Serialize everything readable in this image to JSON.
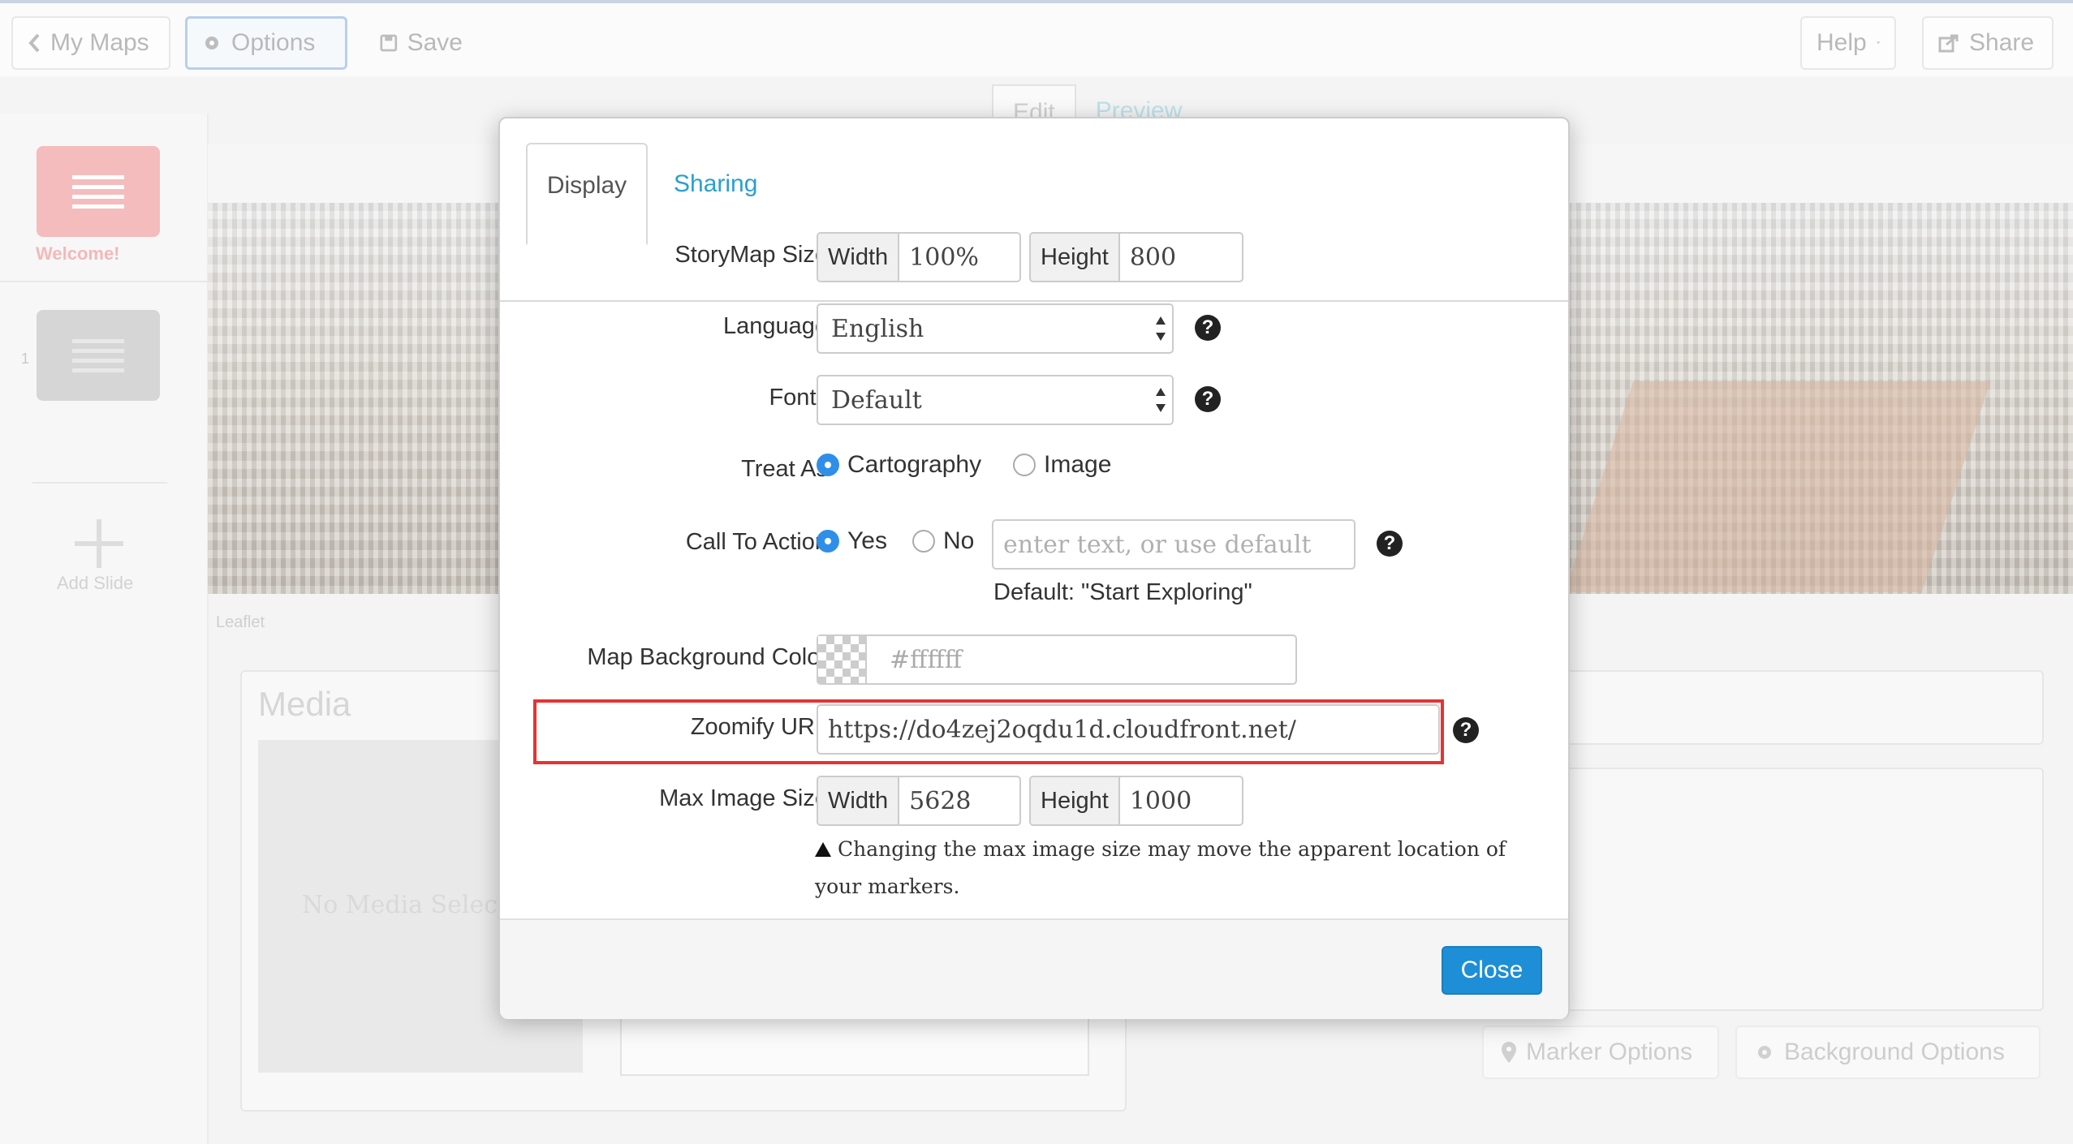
{
  "toolbar": {
    "my_maps": "My Maps",
    "options": "Options",
    "save": "Save",
    "help": "Help",
    "share": "Share"
  },
  "editor_tabs": {
    "edit": "Edit",
    "preview": "Preview"
  },
  "sidebar": {
    "welcome_label": "Welcome!",
    "slide_number": "1",
    "add_slide": "Add Slide"
  },
  "map": {
    "attribution": "Leaflet"
  },
  "media_panel": {
    "title": "Media",
    "empty_text": "No Media Selected"
  },
  "bottom_buttons": {
    "marker_options": "Marker Options",
    "background_options": "Background Options"
  },
  "modal": {
    "tabs": {
      "display": "Display",
      "sharing": "Sharing"
    },
    "storymap_size": {
      "label": "StoryMap Size",
      "width_label": "Width",
      "width_value": "100%",
      "height_label": "Height",
      "height_value": "800"
    },
    "language": {
      "label": "Language",
      "value": "English"
    },
    "fonts": {
      "label": "Fonts",
      "value": "Default"
    },
    "treat_as": {
      "label": "Treat As",
      "option1": "Cartography",
      "option2": "Image",
      "selected": "Cartography"
    },
    "call_to_action": {
      "label": "Call To Action",
      "yes": "Yes",
      "no": "No",
      "selected": "Yes",
      "placeholder": "enter text, or use default",
      "default_hint": "Default: \"Start Exploring\""
    },
    "background_color": {
      "label": "Map Background Color",
      "value": "#ffffff"
    },
    "zoomify_url": {
      "label": "Zoomify URL",
      "value": "https://do4zej2oqdu1d.cloudfront.net/"
    },
    "max_image_size": {
      "label": "Max Image Size",
      "width_label": "Width",
      "width_value": "5628",
      "height_label": "Height",
      "height_value": "1000"
    },
    "warning": "Changing the max image size may move the apparent location of your markers.",
    "close": "Close"
  },
  "colors": {
    "accent": "#1e8fd6",
    "link": "#2a9fd0",
    "highlight": "#e53333",
    "radio_on": "#2f8fe8"
  }
}
